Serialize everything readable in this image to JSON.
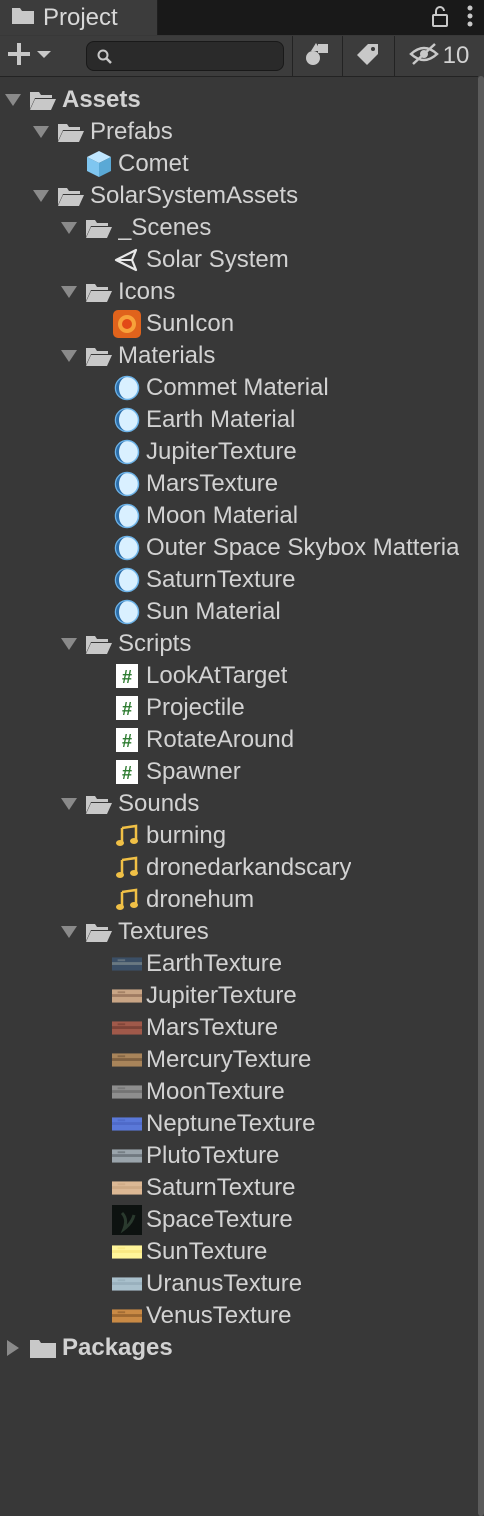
{
  "tab": {
    "title": "Project"
  },
  "toolbar": {
    "hidden_count": "10",
    "search_placeholder": ""
  },
  "tree": [
    {
      "id": "assets",
      "label": "Assets",
      "depth": 0,
      "type": "folder-open",
      "arrow": "down",
      "bold": true
    },
    {
      "id": "prefabs",
      "label": "Prefabs",
      "depth": 1,
      "type": "folder-open",
      "arrow": "down"
    },
    {
      "id": "comet",
      "label": "Comet",
      "depth": 2,
      "type": "prefab",
      "arrow": "none"
    },
    {
      "id": "solarsystemassets",
      "label": "SolarSystemAssets",
      "depth": 1,
      "type": "folder-open",
      "arrow": "down"
    },
    {
      "id": "scenes",
      "label": "_Scenes",
      "depth": 2,
      "type": "folder-open",
      "arrow": "down"
    },
    {
      "id": "solar-system",
      "label": "Solar System",
      "depth": 3,
      "type": "scene",
      "arrow": "none"
    },
    {
      "id": "icons",
      "label": "Icons",
      "depth": 2,
      "type": "folder-open",
      "arrow": "down"
    },
    {
      "id": "sunicon",
      "label": "SunIcon",
      "depth": 3,
      "type": "sunicon",
      "arrow": "none"
    },
    {
      "id": "materials",
      "label": "Materials",
      "depth": 2,
      "type": "folder-open",
      "arrow": "down"
    },
    {
      "id": "commet-material",
      "label": "Commet Material",
      "depth": 3,
      "type": "material",
      "arrow": "none"
    },
    {
      "id": "earth-material",
      "label": "Earth Material",
      "depth": 3,
      "type": "material",
      "arrow": "none"
    },
    {
      "id": "jupitertexture-mat",
      "label": "JupiterTexture",
      "depth": 3,
      "type": "material",
      "arrow": "none"
    },
    {
      "id": "marstexture-mat",
      "label": "MarsTexture",
      "depth": 3,
      "type": "material",
      "arrow": "none"
    },
    {
      "id": "moon-material",
      "label": "Moon Material",
      "depth": 3,
      "type": "material",
      "arrow": "none"
    },
    {
      "id": "outer-space-skybox",
      "label": "Outer Space Skybox Matteria",
      "depth": 3,
      "type": "material",
      "arrow": "none"
    },
    {
      "id": "saturntexture-mat",
      "label": "SaturnTexture",
      "depth": 3,
      "type": "material",
      "arrow": "none"
    },
    {
      "id": "sun-material",
      "label": "Sun Material",
      "depth": 3,
      "type": "material",
      "arrow": "none"
    },
    {
      "id": "scripts",
      "label": "Scripts",
      "depth": 2,
      "type": "folder-open",
      "arrow": "down"
    },
    {
      "id": "lookattarget",
      "label": "LookAtTarget",
      "depth": 3,
      "type": "script",
      "arrow": "none"
    },
    {
      "id": "projectile",
      "label": "Projectile",
      "depth": 3,
      "type": "script",
      "arrow": "none"
    },
    {
      "id": "rotatearound",
      "label": "RotateAround",
      "depth": 3,
      "type": "script",
      "arrow": "none"
    },
    {
      "id": "spawner",
      "label": "Spawner",
      "depth": 3,
      "type": "script",
      "arrow": "none"
    },
    {
      "id": "sounds",
      "label": "Sounds",
      "depth": 2,
      "type": "folder-open",
      "arrow": "down"
    },
    {
      "id": "burning",
      "label": "burning",
      "depth": 3,
      "type": "audio",
      "arrow": "none"
    },
    {
      "id": "dronedarkandscary",
      "label": "dronedarkandscary",
      "depth": 3,
      "type": "audio",
      "arrow": "none"
    },
    {
      "id": "dronehum",
      "label": "dronehum",
      "depth": 3,
      "type": "audio",
      "arrow": "none"
    },
    {
      "id": "textures",
      "label": "Textures",
      "depth": 2,
      "type": "folder-open",
      "arrow": "down"
    },
    {
      "id": "earthtexture",
      "label": "EarthTexture",
      "depth": 3,
      "type": "texture",
      "arrow": "none",
      "colors": [
        "#3b4f66",
        "#7f8b8f"
      ]
    },
    {
      "id": "jupitertexture",
      "label": "JupiterTexture",
      "depth": 3,
      "type": "texture",
      "arrow": "none",
      "colors": [
        "#c9a585",
        "#8d6a52"
      ]
    },
    {
      "id": "marstexture",
      "label": "MarsTexture",
      "depth": 3,
      "type": "texture",
      "arrow": "none",
      "colors": [
        "#a0594a",
        "#6e3a31"
      ]
    },
    {
      "id": "mercurytexture",
      "label": "MercuryTexture",
      "depth": 3,
      "type": "texture",
      "arrow": "none",
      "colors": [
        "#a8845a",
        "#6e5338"
      ]
    },
    {
      "id": "moontexture",
      "label": "MoonTexture",
      "depth": 3,
      "type": "texture",
      "arrow": "none",
      "colors": [
        "#8e8e8e",
        "#6a6a6a"
      ]
    },
    {
      "id": "neptunetexture",
      "label": "NeptuneTexture",
      "depth": 3,
      "type": "texture",
      "arrow": "none",
      "colors": [
        "#5a78d8",
        "#4a64c2"
      ]
    },
    {
      "id": "plutotexture",
      "label": "PlutoTexture",
      "depth": 3,
      "type": "texture",
      "arrow": "none",
      "colors": [
        "#9aa4ab",
        "#5f676d"
      ]
    },
    {
      "id": "saturntexture",
      "label": "SaturnTexture",
      "depth": 3,
      "type": "texture",
      "arrow": "none",
      "colors": [
        "#dcb894",
        "#c9a47f"
      ]
    },
    {
      "id": "spacetexture",
      "label": "SpaceTexture",
      "depth": 3,
      "type": "space",
      "arrow": "none",
      "colors": [
        "#0d1210",
        "#2a3a2e"
      ]
    },
    {
      "id": "suntexture",
      "label": "SunTexture",
      "depth": 3,
      "type": "texture",
      "arrow": "none",
      "colors": [
        "#fff59a",
        "#f6e47a"
      ]
    },
    {
      "id": "uranustexture",
      "label": "UranusTexture",
      "depth": 3,
      "type": "texture",
      "arrow": "none",
      "colors": [
        "#a9c0cc",
        "#93aab6"
      ]
    },
    {
      "id": "venustexture",
      "label": "VenusTexture",
      "depth": 3,
      "type": "texture",
      "arrow": "none",
      "colors": [
        "#c98a45",
        "#8a5a2a"
      ]
    },
    {
      "id": "packages",
      "label": "Packages",
      "depth": 0,
      "type": "folder-closed",
      "arrow": "right",
      "bold": true
    }
  ],
  "colors": {
    "background": "#383838",
    "text": "#d2d2d2",
    "folder": "#c8c8c8",
    "script_green": "#2f7d32",
    "audio_yellow": "#f0c046",
    "material_blue": "#9fd3ff",
    "prefab_blue": "#7fc6f0"
  }
}
